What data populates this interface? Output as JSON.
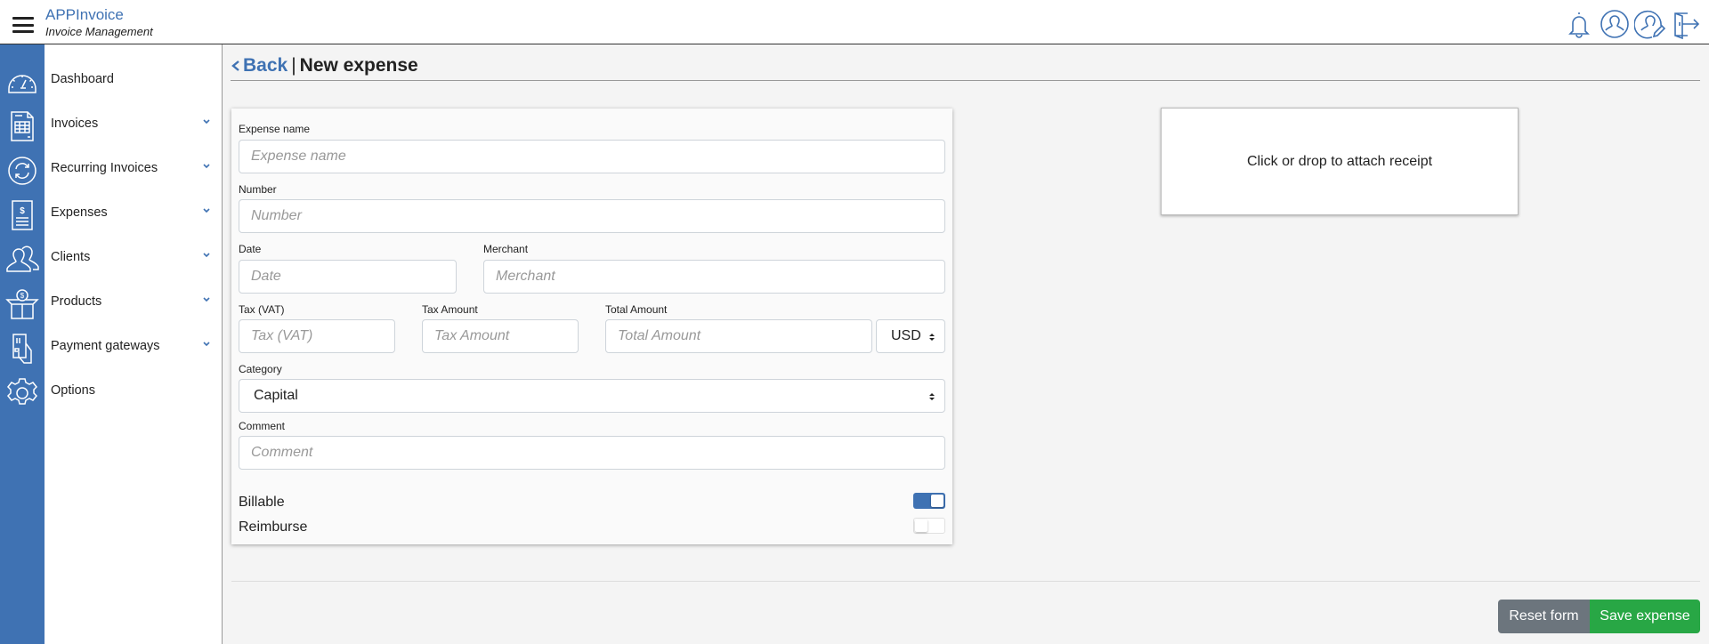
{
  "app": {
    "title": "APPInvoice",
    "subtitle": "Invoice Management"
  },
  "topbar": {
    "icons": [
      "bell-icon",
      "user-profile-icon",
      "edit-profile-icon",
      "logout-icon"
    ]
  },
  "sidebar": {
    "items": [
      {
        "label": "Dashboard",
        "icon": "dashboard-gauge-icon",
        "expandable": false
      },
      {
        "label": "Invoices",
        "icon": "invoice-table-icon",
        "expandable": true
      },
      {
        "label": "Recurring Invoices",
        "icon": "recurring-arrows-icon",
        "expandable": true
      },
      {
        "label": "Expenses",
        "icon": "expense-document-icon",
        "expandable": true
      },
      {
        "label": "Clients",
        "icon": "clients-users-icon",
        "expandable": true
      },
      {
        "label": "Products",
        "icon": "product-box-icon",
        "expandable": true
      },
      {
        "label": "Payment gateways",
        "icon": "payment-card-icon",
        "expandable": true
      },
      {
        "label": "Options",
        "icon": "gear-icon",
        "expandable": false
      }
    ]
  },
  "header": {
    "back_label": "Back",
    "separator": "|",
    "title": "New expense"
  },
  "form": {
    "expense_name": {
      "label": "Expense name",
      "placeholder": "Expense name",
      "value": ""
    },
    "number": {
      "label": "Number",
      "placeholder": "Number",
      "value": ""
    },
    "date": {
      "label": "Date",
      "placeholder": "Date",
      "value": ""
    },
    "merchant": {
      "label": "Merchant",
      "placeholder": "Merchant",
      "value": ""
    },
    "tax_vat": {
      "label": "Tax (VAT)",
      "placeholder": "Tax (VAT)",
      "value": ""
    },
    "tax_amount": {
      "label": "Tax Amount",
      "placeholder": "Tax Amount",
      "value": ""
    },
    "total_amount": {
      "label": "Total Amount",
      "placeholder": "Total Amount",
      "value": ""
    },
    "currency": {
      "selected": "USD"
    },
    "category": {
      "label": "Category",
      "selected": "Capital"
    },
    "comment": {
      "label": "Comment",
      "placeholder": "Comment",
      "value": ""
    },
    "billable": {
      "label": "Billable",
      "checked": true
    },
    "reimburse": {
      "label": "Reimburse",
      "checked": false
    }
  },
  "receipt": {
    "label": "Click or drop to attach receipt"
  },
  "actions": {
    "reset_label": "Reset form",
    "save_label": "Save expense"
  },
  "colors": {
    "brand": "#3f72b3",
    "save": "#28a745",
    "reset": "#6c757d"
  }
}
